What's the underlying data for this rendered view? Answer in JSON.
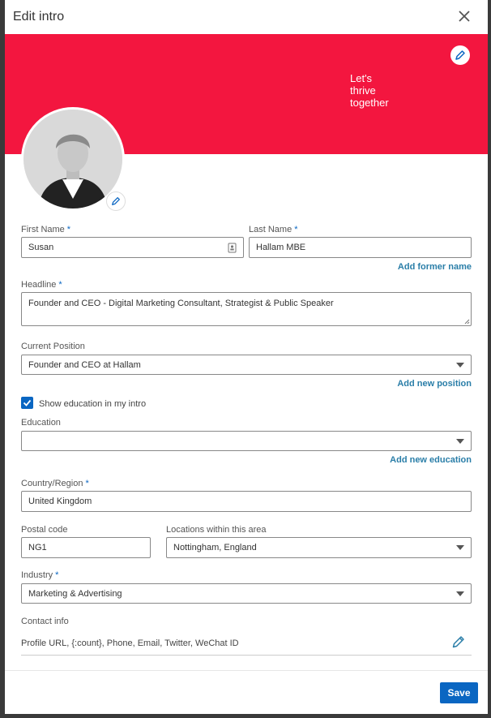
{
  "dialog": {
    "title": "Edit intro"
  },
  "banner": {
    "tagline": [
      "Let's",
      "thrive",
      "together"
    ],
    "color": "#f3163f"
  },
  "form": {
    "first_name": {
      "label": "First Name",
      "required": "*",
      "value": "Susan"
    },
    "last_name": {
      "label": "Last Name",
      "required": "*",
      "value": "Hallam MBE"
    },
    "add_former_name": "Add former name",
    "headline": {
      "label": "Headline",
      "required": "*",
      "value": "Founder and CEO - Digital Marketing Consultant, Strategist & Public Speaker"
    },
    "current_position": {
      "label": "Current Position",
      "value": "Founder and CEO at Hallam"
    },
    "add_new_position": "Add new position",
    "show_education": {
      "label": "Show education in my intro",
      "checked": true
    },
    "education": {
      "label": "Education",
      "value": ""
    },
    "add_new_education": "Add new education",
    "country": {
      "label": "Country/Region",
      "required": "*",
      "value": "United Kingdom"
    },
    "postal_code": {
      "label": "Postal code",
      "value": "NG1"
    },
    "locations": {
      "label": "Locations within this area",
      "value": "Nottingham, England"
    },
    "industry": {
      "label": "Industry",
      "required": "*",
      "value": "Marketing & Advertising"
    },
    "contact_info": {
      "label": "Contact info",
      "value": "Profile URL, {:count}, Phone, Email, Twitter, WeChat ID"
    }
  },
  "footer": {
    "save_label": "Save"
  },
  "colors": {
    "accent": "#0a66c2",
    "link": "#2a7ea8"
  }
}
